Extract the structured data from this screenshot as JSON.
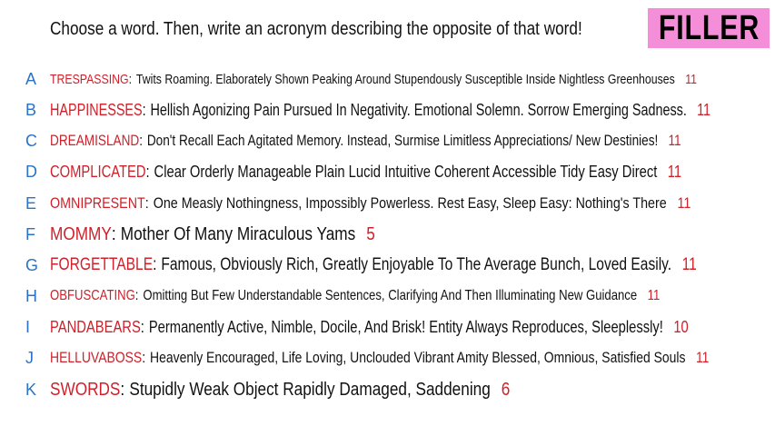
{
  "prompt": "Choose a word. Then, write an acronym describing the opposite of that word!",
  "badge": "FILLER",
  "colors": {
    "letter": "#2a73c6",
    "word": "#d0202a",
    "badge_bg": "#f58ed8"
  },
  "rows": [
    {
      "letter": "A",
      "word": "TRESPASSING",
      "acronym": "Twits Roaming. Elaborately Shown Peaking Around Stupendously Susceptible Inside Nightless Greenhouses",
      "count": "11"
    },
    {
      "letter": "B",
      "word": "HAPPINESSES",
      "acronym": "Hellish Agonizing Pain Pursued In Negativity. Emotional Solemn. Sorrow Emerging Sadness.",
      "count": "11"
    },
    {
      "letter": "C",
      "word": "DREAMISLAND",
      "acronym": "Don't Recall Each Agitated Memory. Instead, Surmise Limitless Appreciations/ New Destinies!",
      "count": "11"
    },
    {
      "letter": "D",
      "word": "COMPLICATED",
      "acronym": "Clear Orderly Manageable Plain Lucid Intuitive Coherent Accessible Tidy Easy Direct",
      "count": "11"
    },
    {
      "letter": "E",
      "word": "OMNIPRESENT",
      "acronym": "One Measly Nothingness, Impossibly Powerless. Rest Easy, Sleep Easy: Nothing's There",
      "count": "11"
    },
    {
      "letter": "F",
      "word": "MOMMY",
      "acronym": "Mother Of Many Miraculous Yams",
      "count": "5"
    },
    {
      "letter": "G",
      "word": "FORGETTABLE",
      "acronym": "Famous, Obviously Rich, Greatly Enjoyable To The Average Bunch, Loved Easily.",
      "count": "11"
    },
    {
      "letter": "H",
      "word": "OBFUSCATING",
      "acronym": "Omitting But Few Understandable Sentences, Clarifying And Then Illuminating New Guidance",
      "count": "11"
    },
    {
      "letter": "I",
      "word": "PANDABEARS",
      "acronym": "Permanently Active, Nimble, Docile, And Brisk! Entity Always Reproduces, Sleeplessly!",
      "count": "10"
    },
    {
      "letter": "J",
      "word": "HELLUVABOSS",
      "acronym": "Heavenly Encouraged, Life Loving, Unclouded Vibrant Amity Blessed, Omnious, Satisfied Souls",
      "count": "11"
    },
    {
      "letter": "K",
      "word": "SWORDS",
      "acronym": "Stupidly Weak Object Rapidly Damaged, Saddening",
      "count": "6"
    }
  ]
}
